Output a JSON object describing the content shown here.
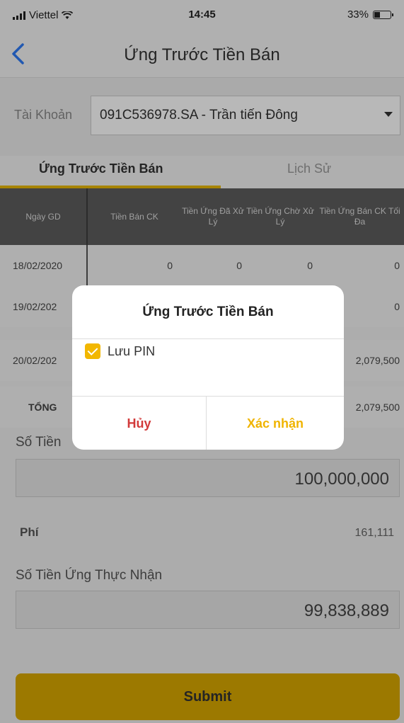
{
  "status_bar": {
    "carrier": "Viettel",
    "time": "14:45",
    "battery": "33%"
  },
  "header": {
    "title": "Ứng Trước Tiền Bán"
  },
  "account": {
    "label": "Tài Khoản",
    "value": "091C536978.SA - Trần tiến Đông"
  },
  "tabs": [
    {
      "label": "Ứng Trước Tiền Bán",
      "active": true
    },
    {
      "label": "Lịch Sử",
      "active": false
    }
  ],
  "table": {
    "headers": [
      "Ngày GD",
      "Tiền Bán CK",
      "Tiền Ứng Đã Xử Lý",
      "Tiền Ứng Chờ Xử Lý",
      "Tiền Ứng Bán CK Tối Đa"
    ],
    "rows": [
      {
        "date": "18/02/2020",
        "sold": "0",
        "processed": "0",
        "pending": "0",
        "max": "0"
      },
      {
        "date": "19/02/202",
        "max": "0"
      },
      {
        "date": "20/02/202",
        "max": "2,079,500"
      }
    ],
    "total": {
      "label": "TỔNG",
      "max": "2,079,500"
    }
  },
  "form": {
    "amount_label": "Số Tiền",
    "amount_value": "100,000,000",
    "fee_label": "Phí",
    "fee_value": "161,111",
    "net_label": "Số Tiền Ứng Thực Nhận",
    "net_value": "99,838,889",
    "submit_label": "Submit"
  },
  "dialog": {
    "title": "Ứng Trước Tiền Bán",
    "checkbox_label": "Lưu PIN",
    "checked": true,
    "cancel_label": "Hủy",
    "confirm_label": "Xác nhận"
  },
  "colors": {
    "accent": "#f0b400",
    "submit": "#d9a800",
    "cancel": "#d23a3a",
    "back": "#2f7bf5"
  }
}
